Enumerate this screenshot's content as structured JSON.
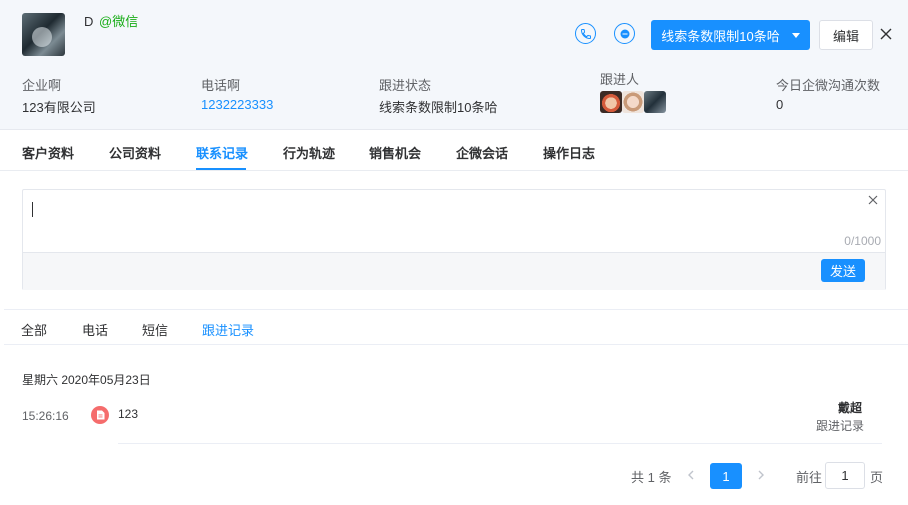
{
  "contact": {
    "name": "D",
    "channel": "@微信"
  },
  "actions": {
    "status_button": "线索条数限制10条哈",
    "edit_button": "编辑"
  },
  "info": {
    "company_label": "企业啊",
    "company_value": "123有限公司",
    "phone_label": "电话啊",
    "phone_value": "1232223333",
    "status_label": "跟进状态",
    "status_value": "线索条数限制10条哈",
    "follower_label": "跟进人",
    "today_label": "今日企微沟通次数",
    "today_value": "0"
  },
  "tabs": [
    "客户资料",
    "公司资料",
    "联系记录",
    "行为轨迹",
    "销售机会",
    "企微会话",
    "操作日志"
  ],
  "active_tab": "联系记录",
  "editor": {
    "counter": "0/1000",
    "send_button": "发送"
  },
  "subtabs": [
    "全部",
    "电话",
    "短信",
    "跟进记录"
  ],
  "active_subtab": "跟进记录",
  "records": {
    "date": "星期六 2020年05月23日",
    "items": [
      {
        "time": "15:26:16",
        "content": "123",
        "user": "戴超",
        "type": "跟进记录"
      }
    ]
  },
  "pagination": {
    "total": "共 1 条",
    "current_page": "1",
    "goto_label": "前往",
    "goto_value": "1",
    "page_suffix": "页"
  },
  "colors": {
    "primary": "#1890ff",
    "wechat": "#1aad19",
    "record_icon": "#f56c6c"
  },
  "icons": {
    "phone": "phone-icon",
    "chat": "chat-icon",
    "close": "close-icon",
    "clear": "clear-icon",
    "record": "document-icon",
    "prev": "chevron-left-icon",
    "next": "chevron-right-icon"
  }
}
